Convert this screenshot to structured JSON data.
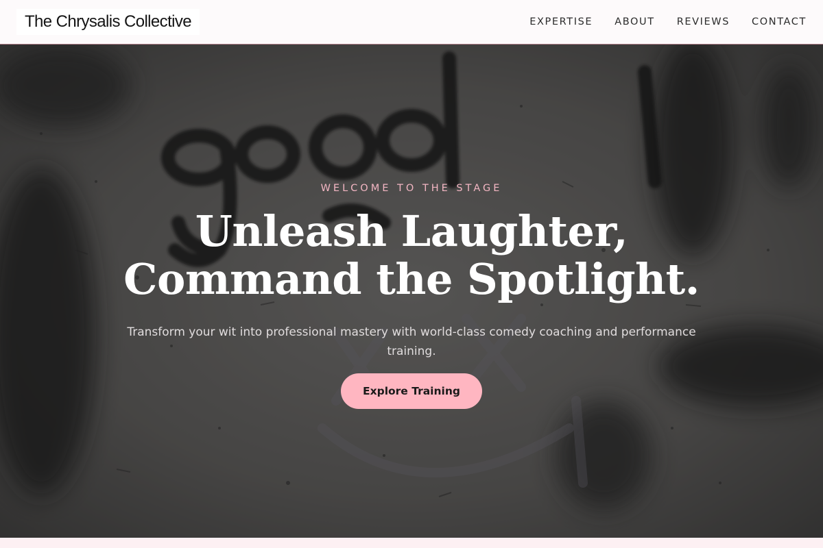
{
  "header": {
    "logo": "The Chrysalis Collective",
    "nav": [
      {
        "label": "EXPERTISE"
      },
      {
        "label": "ABOUT"
      },
      {
        "label": "REVIEWS"
      },
      {
        "label": "CONTACT"
      }
    ]
  },
  "hero": {
    "eyebrow": "WELCOME TO THE STAGE",
    "headline_line1": "Unleash Laughter,",
    "headline_line2": "Command the Spotlight.",
    "subtext": "Transform your wit into professional mastery with world-class comedy coaching and performance training.",
    "cta_label": "Explore Training",
    "background_text": "good",
    "colors": {
      "accent": "#ffb6c1",
      "eyebrow": "#f3b6c3",
      "overlay": "#141414"
    }
  }
}
